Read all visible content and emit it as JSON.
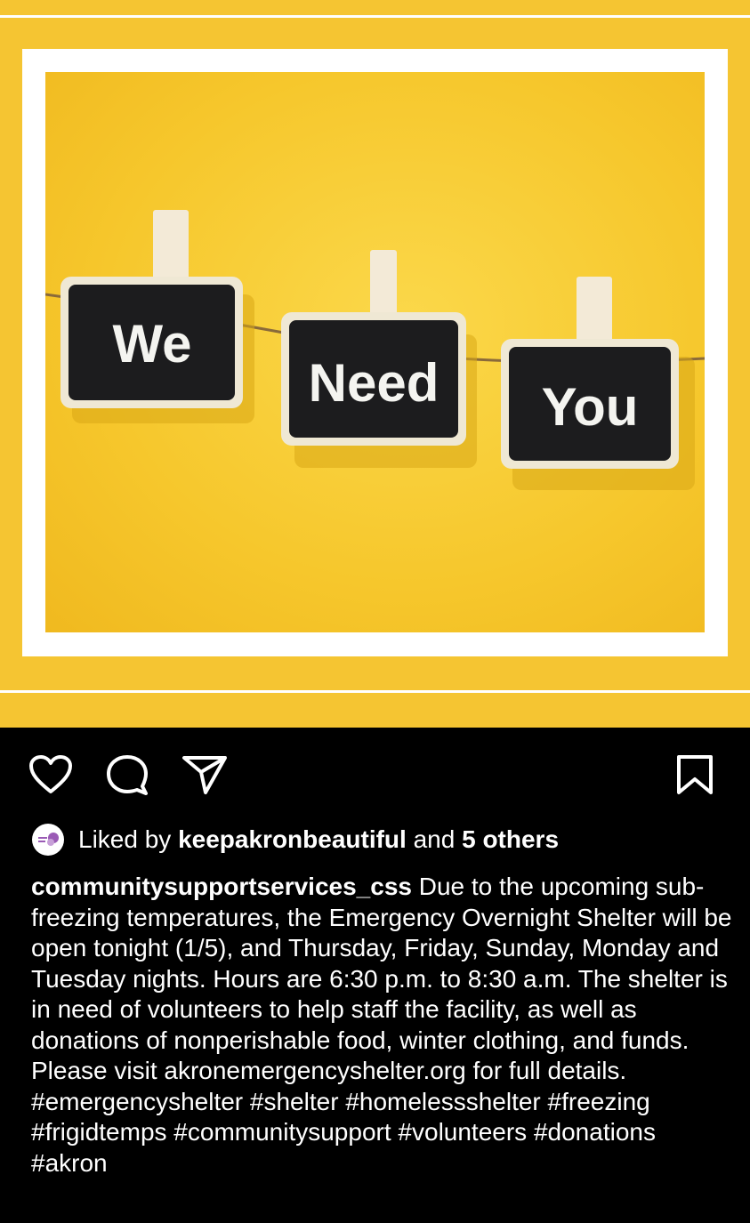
{
  "image": {
    "signs": [
      "We",
      "Need",
      "You"
    ],
    "background_color": "#f5c532"
  },
  "actions": {
    "like_icon": "heart-icon",
    "comment_icon": "comment-icon",
    "share_icon": "send-icon",
    "save_icon": "bookmark-icon"
  },
  "likes": {
    "prefix": "Liked by",
    "user": "keepakronbeautiful",
    "middle": "and",
    "others": "5 others"
  },
  "caption": {
    "username": "communitysupportservices_css",
    "text": "Due to the upcoming sub-freezing temperatures, the Emergency Overnight Shelter will be open tonight (1/5), and Thursday, Friday, Sunday, Monday and Tuesday nights. Hours are 6:30 p.m. to 8:30 a.m. The shelter is in need of volunteers to help staff the facility, as well as donations of nonperishable food, winter clothing, and funds. Please visit akronemergencyshelter.org for full details.",
    "hashtags": [
      "#emergencyshelter",
      "#shelter",
      "#homelessshelter",
      "#freezing",
      "#frigidtemps",
      "#communitysupport",
      "#volunteers",
      "#donations",
      "#akron"
    ]
  }
}
